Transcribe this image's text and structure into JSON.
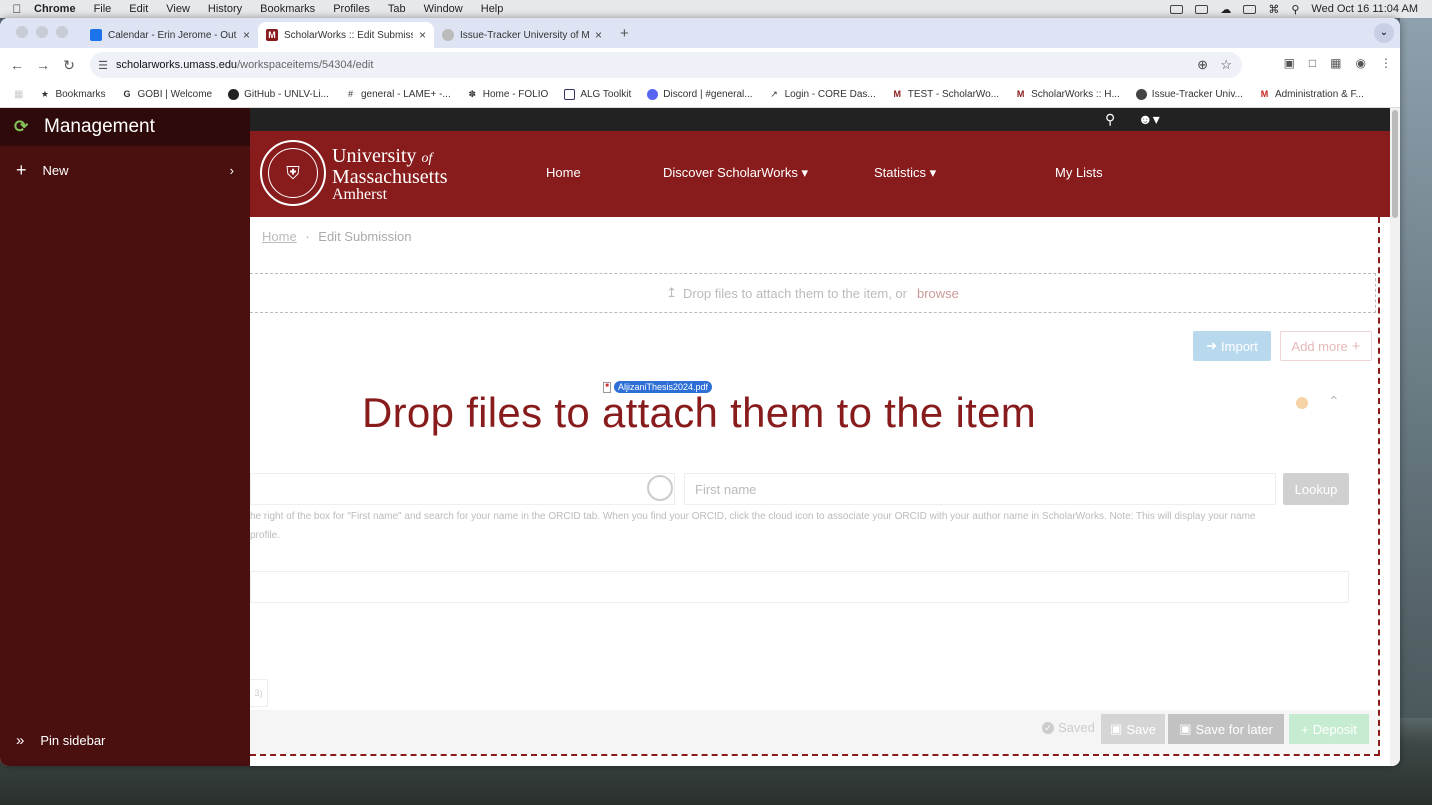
{
  "menubar": {
    "app": "Chrome",
    "items": [
      "File",
      "Edit",
      "View",
      "History",
      "Bookmarks",
      "Profiles",
      "Tab",
      "Window",
      "Help"
    ],
    "datetime": "Wed Oct 16  11:04 AM"
  },
  "tabs": [
    {
      "title": "Calendar - Erin Jerome - Out",
      "favicon_color": "#1a73e8",
      "active": false
    },
    {
      "title": "ScholarWorks :: Edit Submiss",
      "favicon_color": "#881c1c",
      "active": true
    },
    {
      "title": "Issue-Tracker University of M",
      "favicon_color": "#999999",
      "active": false
    }
  ],
  "address": {
    "host": "scholarworks.umass.edu",
    "path": "/workspaceitems/54304/edit"
  },
  "bookmarks": [
    "Bookmarks",
    "GOBI | Welcome",
    "GitHub - UNLV-Li...",
    "general - LAME+ -...",
    "Home - FOLIO",
    "ALG Toolkit",
    "Discord | #general...",
    "Login - CORE Das...",
    "TEST - ScholarWo...",
    "ScholarWorks :: H...",
    "Issue-Tracker Univ...",
    "Administration & F..."
  ],
  "sidebar": {
    "title": "Management",
    "new_label": "New",
    "pin_label": "Pin sidebar"
  },
  "header": {
    "wordmark_line1": "University",
    "wordmark_of": "of",
    "wordmark_line2": "Massachusetts",
    "wordmark_line3": "Amherst",
    "nav": [
      "Home",
      "Discover ScholarWorks",
      "Statistics",
      "My Lists"
    ]
  },
  "breadcrumb": {
    "home": "Home",
    "sep": "·",
    "current": "Edit Submission"
  },
  "dropzone": {
    "text": "Drop files to attach them to the item, or",
    "browse": "browse"
  },
  "buttons": {
    "import": "Import",
    "add_more": "Add more"
  },
  "overlay": {
    "text": "Drop files to attach them to the item",
    "dragged_file": "AljizaniThesis2024.pdf"
  },
  "author": {
    "first_name_placeholder": "First name",
    "lookup": "Lookup",
    "help_line1": "he right of the box for \"First name\" and search for your name in the ORCID tab. When you find your ORCID, click the cloud icon to associate your ORCID with your author name in ScholarWorks. Note: This will display your name",
    "help_line2": " profile."
  },
  "tab_fragment": "3)",
  "footer": {
    "saved": "Saved",
    "save": "Save",
    "save_later": "Save for later",
    "deposit": "Deposit"
  }
}
